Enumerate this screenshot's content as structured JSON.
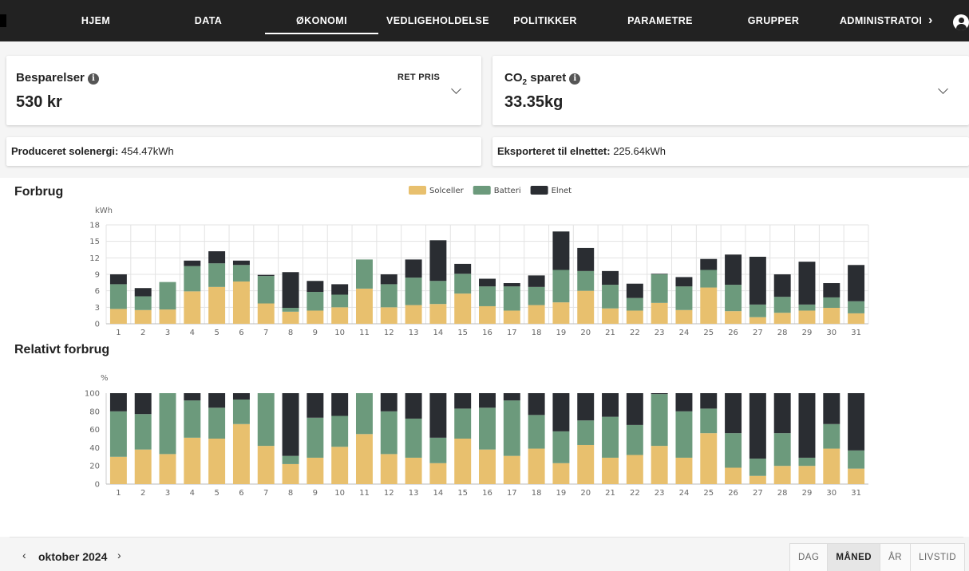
{
  "nav": {
    "items": [
      {
        "label": "HJEM"
      },
      {
        "label": "DATA"
      },
      {
        "label": "ØKONOMI",
        "active": true
      },
      {
        "label": "VEDLIGEHOLDELSE"
      },
      {
        "label": "POLITIKKER"
      },
      {
        "label": "PARAMETRE"
      },
      {
        "label": "GRUPPER"
      },
      {
        "label": "ADMINISTRATOI"
      }
    ],
    "more_icon": "chevron-right-icon",
    "user_icon": "account-circle-icon"
  },
  "savings": {
    "label": "Besparelser",
    "value": "530 kr",
    "action": "RET PRIS"
  },
  "co2": {
    "label_prefix": "CO",
    "label_sub": "2",
    "label_suffix": " sparet",
    "value": "33.35kg"
  },
  "produced": {
    "label": "Produceret solenergi:",
    "value": " 454.47kWh"
  },
  "exported": {
    "label": "Eksporteret til elnettet:",
    "value": " 225.64kWh"
  },
  "colors": {
    "solar": "#e8c06e",
    "battery": "#6c9a7c",
    "grid": "#2a2d32"
  },
  "chart_data": [
    {
      "type": "bar",
      "stacked": true,
      "title": "Forbrug",
      "ylabel": "kWh",
      "ylim": [
        0,
        18
      ],
      "yticks": [
        0,
        3,
        6,
        9,
        12,
        15,
        18
      ],
      "grid": true,
      "legend": "top-center",
      "categories": [
        "1",
        "2",
        "3",
        "4",
        "5",
        "6",
        "7",
        "8",
        "9",
        "10",
        "11",
        "12",
        "13",
        "14",
        "15",
        "16",
        "17",
        "18",
        "19",
        "20",
        "21",
        "22",
        "23",
        "24",
        "25",
        "26",
        "27",
        "28",
        "29",
        "30",
        "31"
      ],
      "series": [
        {
          "name": "Solceller",
          "values": [
            2.7,
            2.5,
            2.6,
            5.9,
            6.7,
            7.7,
            3.7,
            2.2,
            2.4,
            3.0,
            6.4,
            3.0,
            3.4,
            3.6,
            5.5,
            3.2,
            2.4,
            3.4,
            3.9,
            6.0,
            2.8,
            2.4,
            3.8,
            2.5,
            6.6,
            2.3,
            1.2,
            2.0,
            2.4,
            2.9,
            1.9
          ]
        },
        {
          "name": "Batteri",
          "values": [
            4.5,
            2.5,
            5.0,
            4.6,
            4.3,
            3.0,
            5.0,
            0.7,
            3.4,
            2.3,
            5.3,
            4.2,
            5.0,
            4.2,
            3.6,
            3.6,
            4.4,
            3.3,
            5.9,
            3.6,
            4.3,
            2.3,
            5.2,
            4.3,
            3.2,
            4.8,
            2.3,
            2.9,
            1.1,
            1.9,
            2.2
          ]
        },
        {
          "name": "Elnet",
          "values": [
            1.8,
            1.5,
            0.0,
            1.0,
            2.2,
            0.8,
            0.2,
            6.5,
            2.0,
            1.9,
            0.0,
            1.8,
            3.3,
            7.4,
            1.8,
            1.4,
            0.6,
            2.1,
            7.0,
            4.2,
            2.5,
            2.6,
            0.1,
            1.7,
            2.0,
            5.5,
            8.7,
            4.1,
            7.8,
            2.6,
            6.6
          ]
        }
      ]
    },
    {
      "type": "bar",
      "stacked": true,
      "title": "Relativt forbrug",
      "ylabel": "%",
      "ylim": [
        0,
        100
      ],
      "yticks": [
        0,
        20,
        40,
        60,
        80,
        100
      ],
      "grid": false,
      "categories": [
        "1",
        "2",
        "3",
        "4",
        "5",
        "6",
        "7",
        "8",
        "9",
        "10",
        "11",
        "12",
        "13",
        "14",
        "15",
        "16",
        "17",
        "18",
        "19",
        "20",
        "21",
        "22",
        "23",
        "24",
        "25",
        "26",
        "27",
        "28",
        "29",
        "30",
        "31"
      ],
      "series": [
        {
          "name": "Solceller",
          "values": [
            30,
            38,
            33,
            51,
            50,
            66,
            42,
            22,
            29,
            41,
            55,
            33,
            29,
            23,
            50,
            38,
            31,
            39,
            23,
            43,
            29,
            32,
            42,
            29,
            56,
            18,
            9,
            20,
            20,
            39,
            17
          ]
        },
        {
          "name": "Batteri",
          "values": [
            50,
            39,
            67,
            41,
            34,
            27,
            58,
            9,
            44,
            34,
            45,
            47,
            43,
            28,
            33,
            46,
            61,
            37,
            35,
            27,
            45,
            33,
            57,
            51,
            27,
            38,
            19,
            36,
            9,
            27,
            20
          ]
        },
        {
          "name": "Elnet",
          "values": [
            20,
            23,
            0,
            8,
            16,
            7,
            0,
            69,
            27,
            25,
            0,
            20,
            28,
            49,
            17,
            16,
            8,
            24,
            42,
            30,
            26,
            35,
            1,
            20,
            17,
            44,
            72,
            44,
            71,
            34,
            63
          ]
        }
      ]
    }
  ],
  "period": {
    "label": "oktober 2024",
    "prev_icon": "chevron-left-icon",
    "next_icon": "chevron-right-icon"
  },
  "ranges": [
    {
      "label": "DAG"
    },
    {
      "label": "MÅNED",
      "active": true
    },
    {
      "label": "ÅR"
    },
    {
      "label": "LIVSTID"
    }
  ]
}
